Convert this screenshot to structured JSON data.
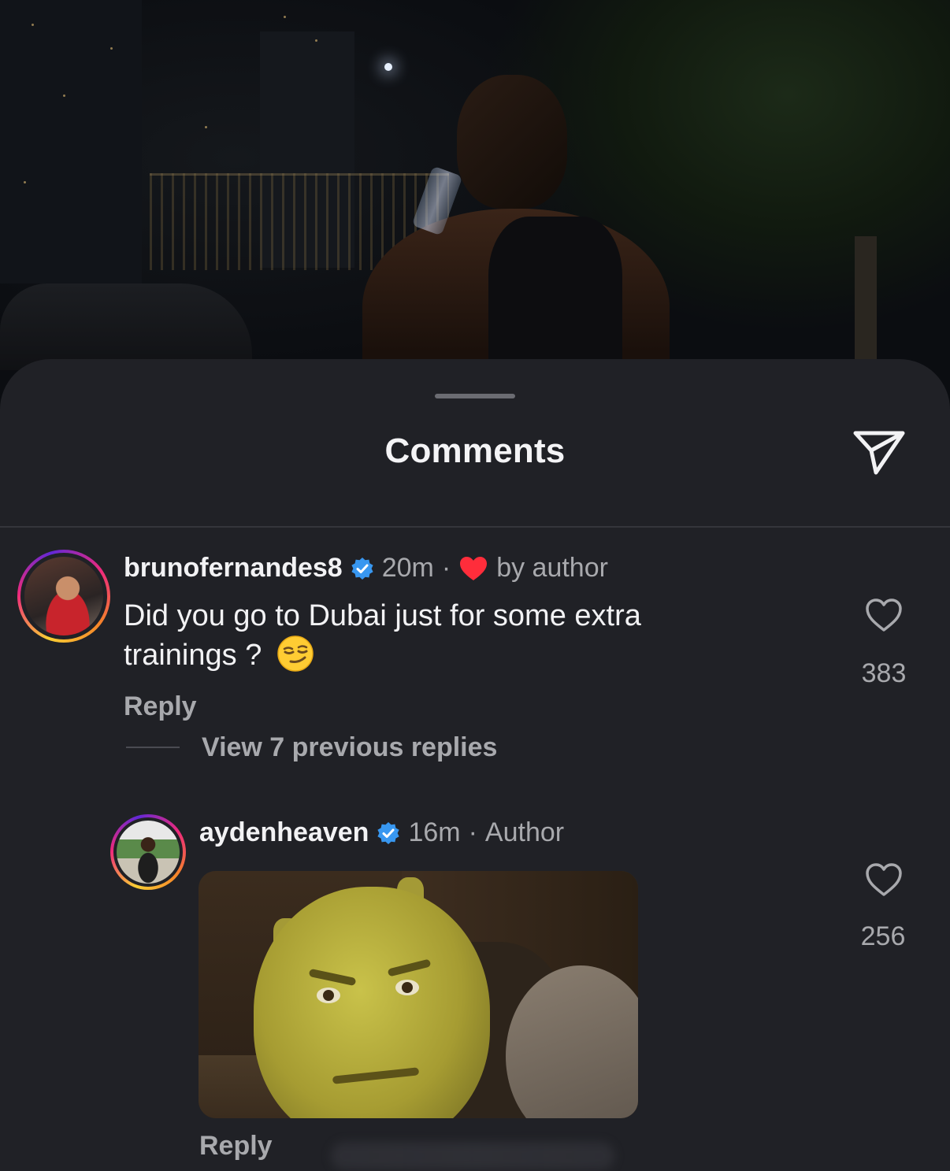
{
  "sheet": {
    "title": "Comments"
  },
  "comments": [
    {
      "username": "brunofernandes8",
      "verified": true,
      "time": "20m",
      "separator": "·",
      "liked_by_author": "by author",
      "text": "Did you go to Dubai just for some extra trainings ?",
      "emoji": "smirking-face",
      "reply_label": "Reply",
      "view_replies_label": "View 7 previous replies",
      "like_count": "383"
    },
    {
      "username": "aydenheaven",
      "verified": true,
      "time": "16m",
      "separator": "·",
      "role": "Author",
      "attachment": "gif",
      "reply_label": "Reply",
      "like_count": "256"
    }
  ],
  "colors": {
    "sheet_bg": "#202126",
    "verified_blue": "#3897f0",
    "heart_red": "#ff2d3b",
    "secondary_text": "#a8a9ad"
  },
  "icons": [
    "send-icon",
    "verified-badge-icon",
    "heart-filled-icon",
    "heart-outline-icon"
  ]
}
